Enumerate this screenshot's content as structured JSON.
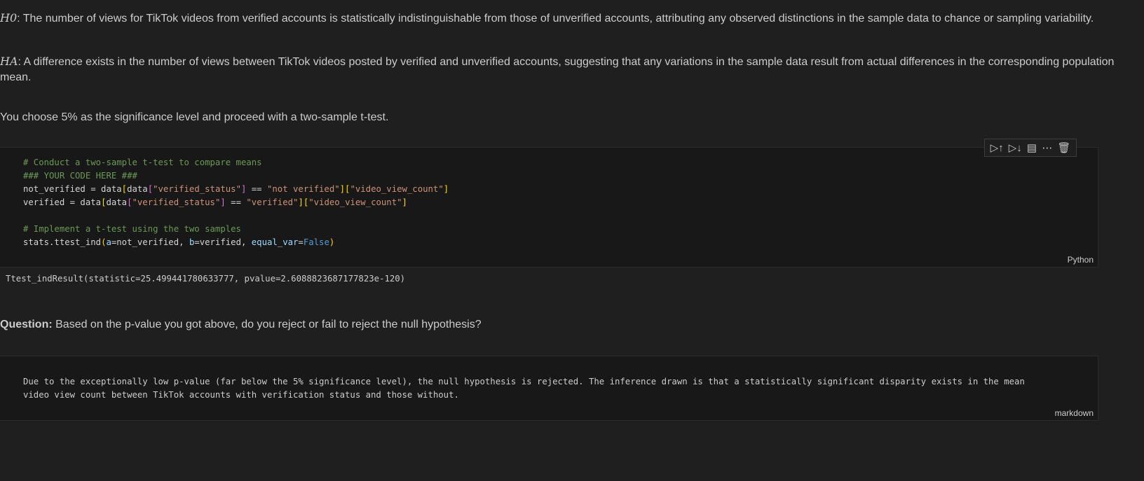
{
  "markdown_top": {
    "h0_label": "H0",
    "h0_text": ": The number of views for TikTok videos from verified accounts is statistically indistinguishable from those of unverified accounts, attributing any observed distinctions in the sample data to chance or sampling variability.",
    "ha_label": "HA",
    "ha_text": ": A difference exists in the number of views between TikTok videos posted by verified and unverified accounts, suggesting that any variations in the sample data result from actual differences in the corresponding population mean.",
    "significance": "You choose 5% as the significance level and proceed with a two-sample t-test."
  },
  "toolbar": {
    "icons": [
      "run-above-icon",
      "run-below-icon",
      "split-cell-icon",
      "more-icon",
      "delete-icon"
    ]
  },
  "code_cell": {
    "language": "Python",
    "lines": [
      [
        [
          "c",
          "# Conduct a two-sample t-test to compare means"
        ]
      ],
      [
        [
          "c",
          "### YOUR CODE HERE ###"
        ]
      ],
      [
        [
          "p",
          "not_verified = data"
        ],
        [
          "b1",
          "["
        ],
        [
          "p",
          "data"
        ],
        [
          "b2",
          "["
        ],
        [
          "s",
          "\"verified_status\""
        ],
        [
          "b2",
          "]"
        ],
        [
          "p",
          " == "
        ],
        [
          "s",
          "\"not verified\""
        ],
        [
          "b1",
          "]["
        ],
        [
          "s",
          "\"video_view_count\""
        ],
        [
          "b1",
          "]"
        ]
      ],
      [
        [
          "p",
          "verified = data"
        ],
        [
          "b1",
          "["
        ],
        [
          "p",
          "data"
        ],
        [
          "b2",
          "["
        ],
        [
          "s",
          "\"verified_status\""
        ],
        [
          "b2",
          "]"
        ],
        [
          "p",
          " == "
        ],
        [
          "s",
          "\"verified\""
        ],
        [
          "b1",
          "]["
        ],
        [
          "s",
          "\"video_view_count\""
        ],
        [
          "b1",
          "]"
        ]
      ],
      [
        [
          "p",
          ""
        ]
      ],
      [
        [
          "c",
          "# Implement a t-test using the two samples"
        ]
      ],
      [
        [
          "p",
          "stats.ttest_ind"
        ],
        [
          "b1",
          "("
        ],
        [
          "v",
          "a"
        ],
        [
          "p",
          "=not_verified, "
        ],
        [
          "v",
          "b"
        ],
        [
          "p",
          "=verified, "
        ],
        [
          "v",
          "equal_var"
        ],
        [
          "p",
          "="
        ],
        [
          "k",
          "False"
        ],
        [
          "b1",
          ")"
        ]
      ]
    ]
  },
  "output": "Ttest_indResult(statistic=25.499441780633777, pvalue=2.6088823687177823e-120)",
  "question": {
    "label": "Question:",
    "text": " Based on the p-value you got above, do you reject or fail to reject the null hypothesis?"
  },
  "answer_cell": {
    "language": "markdown",
    "lines": [
      "Due to the exceptionally low p-value (far below the 5% significance level), the null hypothesis is rejected. The inference drawn is that a statistically significant disparity exists in the mean",
      "video view count between TikTok accounts with verification status and those without."
    ]
  }
}
